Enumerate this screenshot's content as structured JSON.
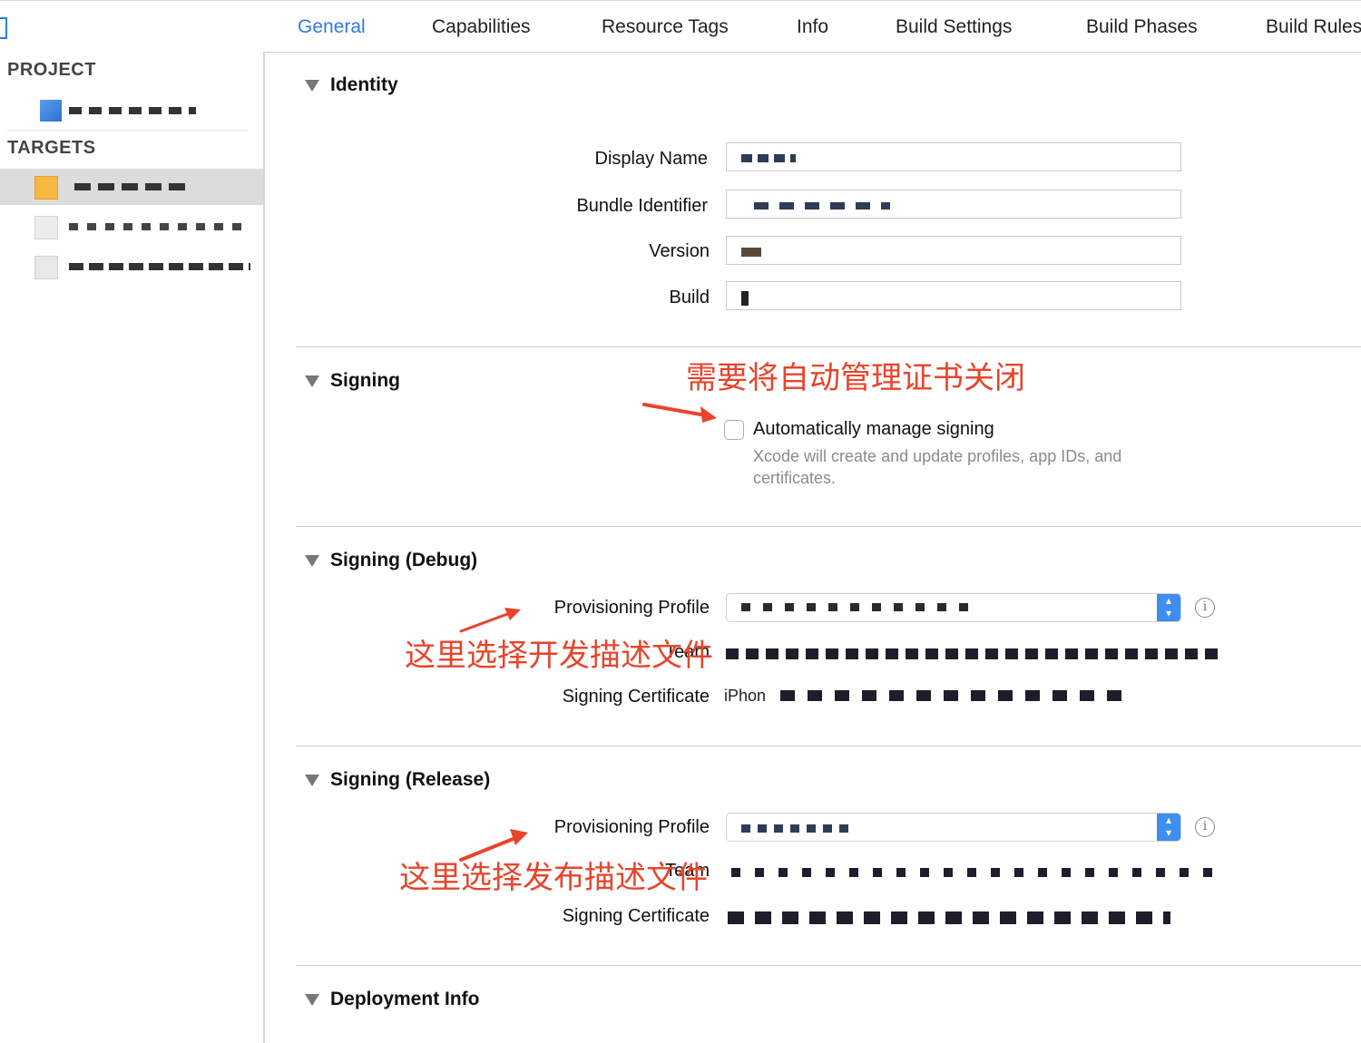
{
  "tabs": [
    {
      "label": "General",
      "active": true
    },
    {
      "label": "Capabilities",
      "active": false
    },
    {
      "label": "Resource Tags",
      "active": false
    },
    {
      "label": "Info",
      "active": false
    },
    {
      "label": "Build Settings",
      "active": false
    },
    {
      "label": "Build Phases",
      "active": false
    },
    {
      "label": "Build Rules",
      "active": false
    }
  ],
  "sidebar": {
    "project_header": "PROJECT",
    "targets_header": "TARGETS"
  },
  "identity": {
    "title": "Identity",
    "display_name_label": "Display Name",
    "bundle_identifier_label": "Bundle Identifier",
    "version_label": "Version",
    "build_label": "Build"
  },
  "signing": {
    "title": "Signing",
    "auto_manage_label": "Automatically manage signing",
    "auto_manage_checked": false,
    "description": "Xcode will create and update profiles, app IDs, and certificates."
  },
  "signing_debug": {
    "title": "Signing (Debug)",
    "provisioning_profile_label": "Provisioning Profile",
    "team_label": "Team",
    "signing_certificate_label": "Signing Certificate",
    "signing_certificate_value": "iPhon"
  },
  "signing_release": {
    "title": "Signing (Release)",
    "provisioning_profile_label": "Provisioning Profile",
    "team_label": "Team",
    "signing_certificate_label": "Signing Certificate"
  },
  "deployment": {
    "title": "Deployment Info"
  },
  "annotations": {
    "auto_signing_note": "需要将自动管理证书关闭",
    "debug_profile_note": "这里选择开发描述文件",
    "release_profile_note": "这里选择发布描述文件",
    "color": "#e8442b"
  },
  "colors": {
    "accent": "#2f7ae5",
    "popup_stepper": "#3d8ef0"
  }
}
